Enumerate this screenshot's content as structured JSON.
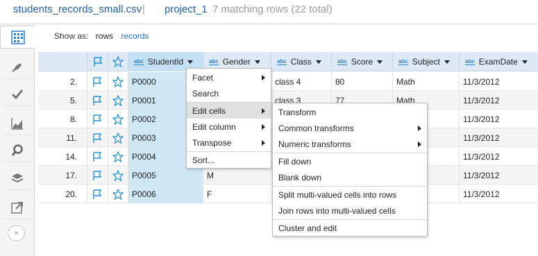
{
  "breadcrumb": {
    "file": "students_records_small.csv",
    "separator": "|",
    "project": "project_1",
    "matching": "7 matching rows (22 total)"
  },
  "sidebar": {
    "items": [
      {
        "name": "grid-icon",
        "active": true
      },
      {
        "name": "pen-icon"
      },
      {
        "name": "check-icon"
      },
      {
        "name": "chart-icon"
      },
      {
        "name": "search-icon"
      },
      {
        "name": "layers-icon"
      },
      {
        "name": "export-icon"
      }
    ],
    "collapse_label": "»"
  },
  "show_as": {
    "label": "Show as:",
    "rows": "rows",
    "records": "records"
  },
  "columns": {
    "student_id": "StudentId",
    "gender": "Gender",
    "class": "Class",
    "score": "Score",
    "subject": "Subject",
    "exam_date": "ExamDate",
    "type_badge": "abc"
  },
  "rows": [
    {
      "idx": "2.",
      "student_id": "P0000",
      "gender": "",
      "class": "class 4",
      "score": "80",
      "subject": "Math",
      "exam_date": "11/3/2012"
    },
    {
      "idx": "5.",
      "student_id": "P0001",
      "gender": "",
      "class": "class 3",
      "score": "77",
      "subject": "Math",
      "exam_date": "11/3/2012"
    },
    {
      "idx": "8.",
      "student_id": "P0002",
      "gender": "",
      "class": "",
      "score": "",
      "subject": "",
      "exam_date": "11/3/2012"
    },
    {
      "idx": "11.",
      "student_id": "P0003",
      "gender": "",
      "class": "",
      "score": "",
      "subject": "",
      "exam_date": "11/3/2012"
    },
    {
      "idx": "14.",
      "student_id": "P0004",
      "gender": "",
      "class": "",
      "score": "",
      "subject": "",
      "exam_date": "11/3/2012"
    },
    {
      "idx": "17.",
      "student_id": "P0005",
      "gender": "M",
      "class": "",
      "score": "",
      "subject": "",
      "exam_date": "11/3/2012"
    },
    {
      "idx": "20.",
      "student_id": "P0006",
      "gender": "F",
      "class": "",
      "score": "",
      "subject": "",
      "exam_date": "11/3/2012"
    }
  ],
  "column_menu": {
    "facet": "Facet",
    "search": "Search",
    "edit_cells": "Edit cells",
    "edit_column": "Edit column",
    "transpose": "Transpose",
    "sort": "Sort..."
  },
  "edit_cells_menu": {
    "transform": "Transform",
    "common_transforms": "Common transforms",
    "numeric_transforms": "Numeric transforms",
    "fill_down": "Fill down",
    "blank_down": "Blank down",
    "split_multi": "Split multi-valued cells into rows",
    "join_multi": "Join rows into multi-valued cells",
    "cluster_edit": "Cluster and edit"
  },
  "colors": {
    "link": "#1f5fa8",
    "header_bg": "#dde9f4",
    "selected_col": "#cfe7f5",
    "star": "#1f8fd6"
  }
}
